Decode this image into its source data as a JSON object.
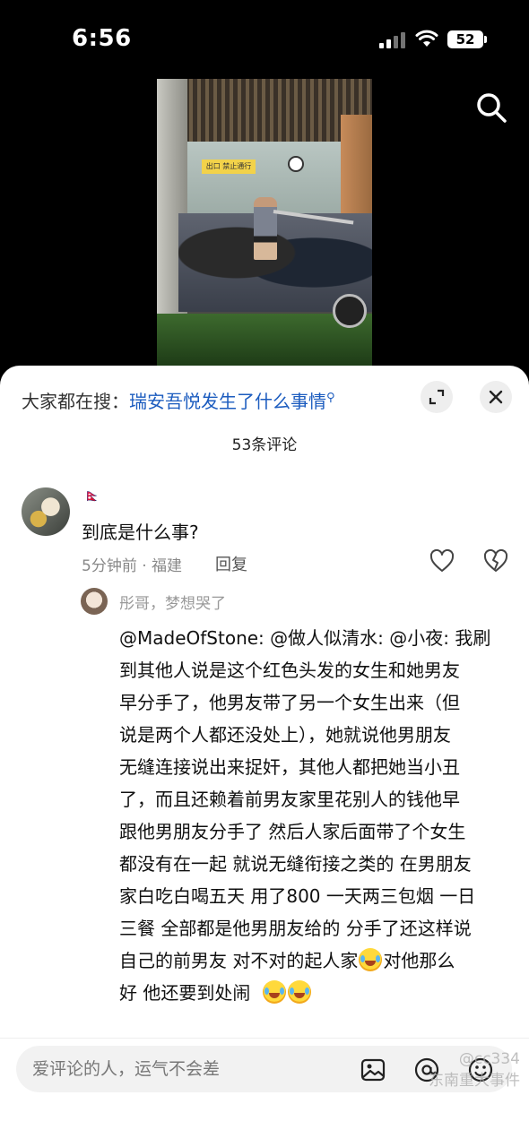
{
  "status_bar": {
    "time": "6:56",
    "battery": "52"
  },
  "video": {
    "sign_text": "出口 禁止通行"
  },
  "sheet": {
    "trending_prefix": "大家都在搜：",
    "trending_query": "瑞安吾悦发生了什么事情",
    "comment_count": "53条评论"
  },
  "comment": {
    "author": "🇳🇵",
    "text": "到底是什么事?",
    "meta": "5分钟前 · 福建",
    "reply_label": "回复"
  },
  "reply": {
    "author": "彤哥，梦想哭了",
    "lines": [
      "@MadeOfStone: @做人似清水: @小夜: 我刷",
      "到其他人说是这个红色头发的女生和她男友",
      "早分手了，他男友带了另一个女生出来（但",
      "说是两个人都还没处上），她就说他男朋友",
      "无缝连接说出来捉奸，其他人都把她当小丑",
      "了，而且还赖着前男友家里花别人的钱他早",
      "跟他男朋友分手了 然后人家后面带了个女生",
      "都没有在一起 就说无缝衔接之类的 在男朋友",
      "家白吃白喝五天 用了800 一天两三包烟 一日",
      "三餐 全部都是他男朋友给的 分手了还这样说",
      "自己的前男友 对不对的起人家",
      "对他那么",
      "好 他还要到处闹"
    ]
  },
  "input": {
    "placeholder": "爱评论的人，运气不会差"
  },
  "watermark": {
    "line1": "@cc334",
    "line2": "东南重大事件"
  },
  "icons": {
    "search": "search-icon",
    "expand": "expand-icon",
    "close": "close-icon",
    "heart": "heart-icon",
    "dislike": "broken-heart-icon",
    "image": "image-icon",
    "at": "at-icon",
    "emoji": "emoji-icon",
    "laugh_cry": "laugh-cry-emoji"
  },
  "colors": {
    "link": "#1c5cbf",
    "background": "#000000",
    "sheet": "#ffffff"
  }
}
